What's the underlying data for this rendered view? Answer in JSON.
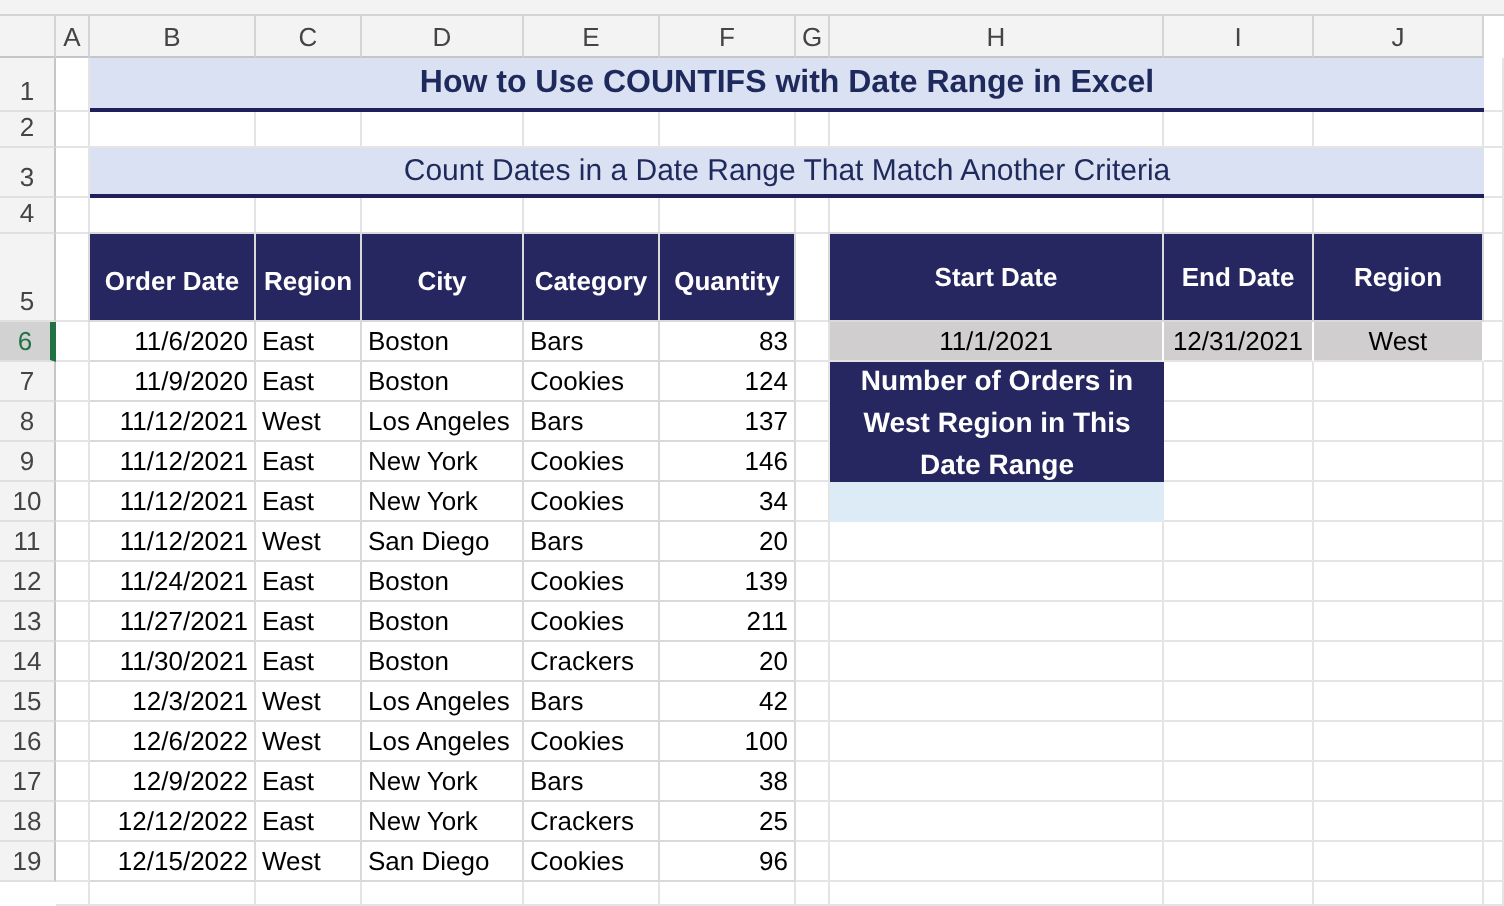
{
  "column_headers": [
    "A",
    "B",
    "C",
    "D",
    "E",
    "F",
    "G",
    "H",
    "I",
    "J"
  ],
  "row_headers": [
    {
      "label": "1",
      "selected": false
    },
    {
      "label": "2",
      "selected": false
    },
    {
      "label": "3",
      "selected": false
    },
    {
      "label": "4",
      "selected": false
    },
    {
      "label": "5",
      "selected": false
    },
    {
      "label": "6",
      "selected": true
    },
    {
      "label": "7",
      "selected": false
    },
    {
      "label": "8",
      "selected": false
    },
    {
      "label": "9",
      "selected": false
    },
    {
      "label": "10",
      "selected": false
    },
    {
      "label": "11",
      "selected": false
    },
    {
      "label": "12",
      "selected": false
    },
    {
      "label": "13",
      "selected": false
    },
    {
      "label": "14",
      "selected": false
    },
    {
      "label": "15",
      "selected": false
    },
    {
      "label": "16",
      "selected": false
    },
    {
      "label": "17",
      "selected": false
    },
    {
      "label": "18",
      "selected": false
    },
    {
      "label": "19",
      "selected": false
    }
  ],
  "title": "How to Use COUNTIFS with Date Range in Excel",
  "subtitle": "Count Dates in a Date Range That Match Another Criteria",
  "orders_table": {
    "columns": [
      "Order Date",
      "Region",
      "City",
      "Category",
      "Quantity"
    ],
    "rows": [
      [
        "11/6/2020",
        "East",
        "Boston",
        "Bars",
        "83"
      ],
      [
        "11/9/2020",
        "East",
        "Boston",
        "Cookies",
        "124"
      ],
      [
        "11/12/2021",
        "West",
        "Los Angeles",
        "Bars",
        "137"
      ],
      [
        "11/12/2021",
        "East",
        "New York",
        "Cookies",
        "146"
      ],
      [
        "11/12/2021",
        "East",
        "New York",
        "Cookies",
        "34"
      ],
      [
        "11/12/2021",
        "West",
        "San Diego",
        "Bars",
        "20"
      ],
      [
        "11/24/2021",
        "East",
        "Boston",
        "Cookies",
        "139"
      ],
      [
        "11/27/2021",
        "East",
        "Boston",
        "Cookies",
        "211"
      ],
      [
        "11/30/2021",
        "East",
        "Boston",
        "Crackers",
        "20"
      ],
      [
        "12/3/2021",
        "West",
        "Los Angeles",
        "Bars",
        "42"
      ],
      [
        "12/6/2022",
        "West",
        "Los Angeles",
        "Cookies",
        "100"
      ],
      [
        "12/9/2022",
        "East",
        "New York",
        "Bars",
        "38"
      ],
      [
        "12/12/2022",
        "East",
        "New York",
        "Crackers",
        "25"
      ],
      [
        "12/15/2022",
        "West",
        "San Diego",
        "Cookies",
        "96"
      ]
    ]
  },
  "criteria_table": {
    "columns": [
      "Start Date",
      "End Date",
      "Region"
    ],
    "values": [
      "11/1/2021",
      "12/31/2021",
      "West"
    ]
  },
  "result_box": {
    "label": "Number of Orders in West Region in This Date Range"
  }
}
